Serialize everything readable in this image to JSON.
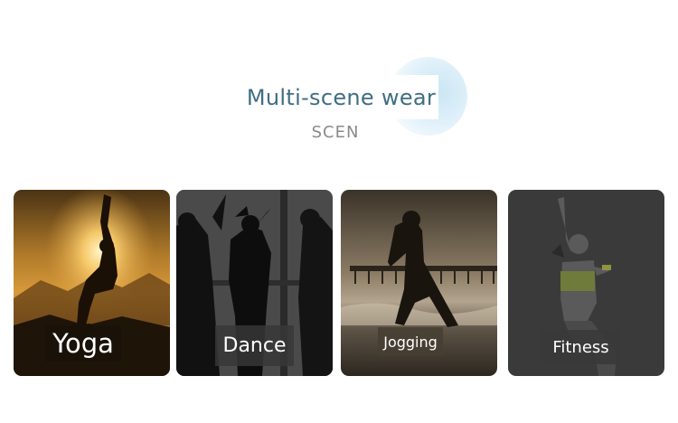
{
  "header": {
    "title": "Multi-scene wear",
    "subtitle": "SCEN"
  },
  "cards": [
    {
      "label": "Yoga",
      "icon": "yoga-silhouette-photo"
    },
    {
      "label": "Dance",
      "icon": "dance-silhouette-photo"
    },
    {
      "label": "Jogging",
      "icon": "jogging-beach-photo"
    },
    {
      "label": "Fitness",
      "icon": "fitness-woman-photo"
    }
  ],
  "colors": {
    "title": "#3f6e82",
    "subtitle": "#8a8a8a",
    "accent_circle": "#cbe6f4"
  }
}
